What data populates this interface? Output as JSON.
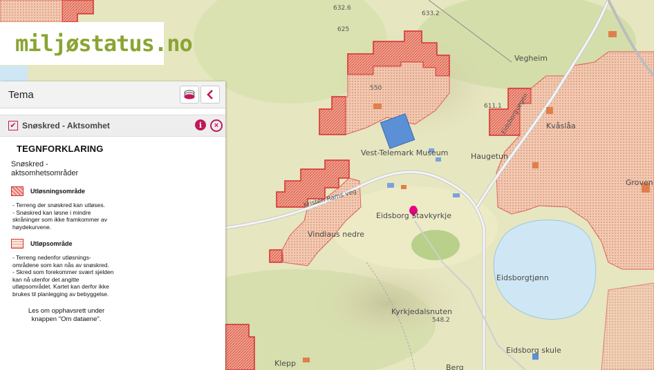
{
  "app": {
    "logo_text": "miljøstatus.no"
  },
  "panel": {
    "title": "Tema",
    "layer": {
      "name": "Snøskred - Aktsomhet",
      "checked": true
    },
    "legend": {
      "title": "TEGNFORKLARING",
      "subtitle": "Snøskred - aktsomhetsområder",
      "entries": [
        {
          "label": "Utløsningsområde",
          "description": "- Terreng der snøskred kan utløses.\n- Snøskred kan løsne i mindre skråninger som ikke framkommer av høydekurvene."
        },
        {
          "label": "Utløpsområde",
          "description": "- Terreng nedenfor utløsnings-områdene som kan nås av snøskred.\n- Skred som forekommer svært sjelden kan nå utenfor det angitte utløpsområdet. Kartet kan derfor ikke brukes til planlegging av bebyggelse."
        }
      ],
      "credit": "Les om opphavsrett under knappen \"Om dataene\"."
    }
  },
  "map": {
    "labels": {
      "museum": "Vest-Telemark Museum",
      "stavkyrkje": "Eidsborg Stavkyrkje",
      "vindlaus": "Vindlaus nedre",
      "haugetun": "Haugetun",
      "vegheim": "Vegheim",
      "kvaslaa": "Kvåslåa",
      "groven": "Groven",
      "tjonn": "Eidsborgtjønn",
      "kyrkjedalsnuten": "Kyrkjedalsnuten",
      "skule": "Eidsborg skule",
      "klepp": "Klepp",
      "berg": "Berg",
      "road1": "Eidsborgvegen",
      "road2": "Kristen Rams veg",
      "elev_6326": "632.6",
      "elev_6332": "633.2",
      "elev_625": "625",
      "elev_550": "550",
      "elev_6111": "611.1",
      "elev_5482": "548.2"
    },
    "colors": {
      "release_fill": "#e9876f",
      "release_border": "#d32f2f",
      "runout_fill": "#f1b79e",
      "water": "#cfe7f4",
      "marker": "#e6007e"
    }
  }
}
